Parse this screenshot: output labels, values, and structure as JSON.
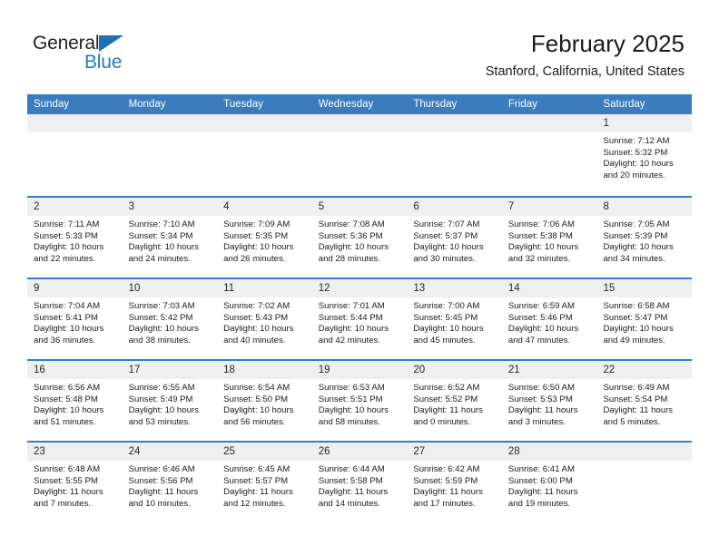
{
  "logo": {
    "word_top": "General",
    "word_bottom": "Blue",
    "triangle_color": "#1f6fb5",
    "blue_color": "#1f7cc4"
  },
  "header": {
    "month_title": "February 2025",
    "location": "Stanford, California, United States"
  },
  "theme": {
    "header_blue": "#3a7cbe",
    "day_strip_gray": "#efefef"
  },
  "labels": {
    "sunrise_prefix": "Sunrise:",
    "sunset_prefix": "Sunset:",
    "daylight_prefix": "Daylight:"
  },
  "weekdays": [
    "Sunday",
    "Monday",
    "Tuesday",
    "Wednesday",
    "Thursday",
    "Friday",
    "Saturday"
  ],
  "weeks": [
    [
      {
        "empty": true
      },
      {
        "empty": true
      },
      {
        "empty": true
      },
      {
        "empty": true
      },
      {
        "empty": true
      },
      {
        "empty": true
      },
      {
        "day": "1",
        "sunrise": "Sunrise: 7:12 AM",
        "sunset": "Sunset: 5:32 PM",
        "daylight_line1": "Daylight: 10 hours",
        "daylight_line2": "and 20 minutes."
      }
    ],
    [
      {
        "day": "2",
        "sunrise": "Sunrise: 7:11 AM",
        "sunset": "Sunset: 5:33 PM",
        "daylight_line1": "Daylight: 10 hours",
        "daylight_line2": "and 22 minutes."
      },
      {
        "day": "3",
        "sunrise": "Sunrise: 7:10 AM",
        "sunset": "Sunset: 5:34 PM",
        "daylight_line1": "Daylight: 10 hours",
        "daylight_line2": "and 24 minutes."
      },
      {
        "day": "4",
        "sunrise": "Sunrise: 7:09 AM",
        "sunset": "Sunset: 5:35 PM",
        "daylight_line1": "Daylight: 10 hours",
        "daylight_line2": "and 26 minutes."
      },
      {
        "day": "5",
        "sunrise": "Sunrise: 7:08 AM",
        "sunset": "Sunset: 5:36 PM",
        "daylight_line1": "Daylight: 10 hours",
        "daylight_line2": "and 28 minutes."
      },
      {
        "day": "6",
        "sunrise": "Sunrise: 7:07 AM",
        "sunset": "Sunset: 5:37 PM",
        "daylight_line1": "Daylight: 10 hours",
        "daylight_line2": "and 30 minutes."
      },
      {
        "day": "7",
        "sunrise": "Sunrise: 7:06 AM",
        "sunset": "Sunset: 5:38 PM",
        "daylight_line1": "Daylight: 10 hours",
        "daylight_line2": "and 32 minutes."
      },
      {
        "day": "8",
        "sunrise": "Sunrise: 7:05 AM",
        "sunset": "Sunset: 5:39 PM",
        "daylight_line1": "Daylight: 10 hours",
        "daylight_line2": "and 34 minutes."
      }
    ],
    [
      {
        "day": "9",
        "sunrise": "Sunrise: 7:04 AM",
        "sunset": "Sunset: 5:41 PM",
        "daylight_line1": "Daylight: 10 hours",
        "daylight_line2": "and 36 minutes."
      },
      {
        "day": "10",
        "sunrise": "Sunrise: 7:03 AM",
        "sunset": "Sunset: 5:42 PM",
        "daylight_line1": "Daylight: 10 hours",
        "daylight_line2": "and 38 minutes."
      },
      {
        "day": "11",
        "sunrise": "Sunrise: 7:02 AM",
        "sunset": "Sunset: 5:43 PM",
        "daylight_line1": "Daylight: 10 hours",
        "daylight_line2": "and 40 minutes."
      },
      {
        "day": "12",
        "sunrise": "Sunrise: 7:01 AM",
        "sunset": "Sunset: 5:44 PM",
        "daylight_line1": "Daylight: 10 hours",
        "daylight_line2": "and 42 minutes."
      },
      {
        "day": "13",
        "sunrise": "Sunrise: 7:00 AM",
        "sunset": "Sunset: 5:45 PM",
        "daylight_line1": "Daylight: 10 hours",
        "daylight_line2": "and 45 minutes."
      },
      {
        "day": "14",
        "sunrise": "Sunrise: 6:59 AM",
        "sunset": "Sunset: 5:46 PM",
        "daylight_line1": "Daylight: 10 hours",
        "daylight_line2": "and 47 minutes."
      },
      {
        "day": "15",
        "sunrise": "Sunrise: 6:58 AM",
        "sunset": "Sunset: 5:47 PM",
        "daylight_line1": "Daylight: 10 hours",
        "daylight_line2": "and 49 minutes."
      }
    ],
    [
      {
        "day": "16",
        "sunrise": "Sunrise: 6:56 AM",
        "sunset": "Sunset: 5:48 PM",
        "daylight_line1": "Daylight: 10 hours",
        "daylight_line2": "and 51 minutes."
      },
      {
        "day": "17",
        "sunrise": "Sunrise: 6:55 AM",
        "sunset": "Sunset: 5:49 PM",
        "daylight_line1": "Daylight: 10 hours",
        "daylight_line2": "and 53 minutes."
      },
      {
        "day": "18",
        "sunrise": "Sunrise: 6:54 AM",
        "sunset": "Sunset: 5:50 PM",
        "daylight_line1": "Daylight: 10 hours",
        "daylight_line2": "and 56 minutes."
      },
      {
        "day": "19",
        "sunrise": "Sunrise: 6:53 AM",
        "sunset": "Sunset: 5:51 PM",
        "daylight_line1": "Daylight: 10 hours",
        "daylight_line2": "and 58 minutes."
      },
      {
        "day": "20",
        "sunrise": "Sunrise: 6:52 AM",
        "sunset": "Sunset: 5:52 PM",
        "daylight_line1": "Daylight: 11 hours",
        "daylight_line2": "and 0 minutes."
      },
      {
        "day": "21",
        "sunrise": "Sunrise: 6:50 AM",
        "sunset": "Sunset: 5:53 PM",
        "daylight_line1": "Daylight: 11 hours",
        "daylight_line2": "and 3 minutes."
      },
      {
        "day": "22",
        "sunrise": "Sunrise: 6:49 AM",
        "sunset": "Sunset: 5:54 PM",
        "daylight_line1": "Daylight: 11 hours",
        "daylight_line2": "and 5 minutes."
      }
    ],
    [
      {
        "day": "23",
        "sunrise": "Sunrise: 6:48 AM",
        "sunset": "Sunset: 5:55 PM",
        "daylight_line1": "Daylight: 11 hours",
        "daylight_line2": "and 7 minutes."
      },
      {
        "day": "24",
        "sunrise": "Sunrise: 6:46 AM",
        "sunset": "Sunset: 5:56 PM",
        "daylight_line1": "Daylight: 11 hours",
        "daylight_line2": "and 10 minutes."
      },
      {
        "day": "25",
        "sunrise": "Sunrise: 6:45 AM",
        "sunset": "Sunset: 5:57 PM",
        "daylight_line1": "Daylight: 11 hours",
        "daylight_line2": "and 12 minutes."
      },
      {
        "day": "26",
        "sunrise": "Sunrise: 6:44 AM",
        "sunset": "Sunset: 5:58 PM",
        "daylight_line1": "Daylight: 11 hours",
        "daylight_line2": "and 14 minutes."
      },
      {
        "day": "27",
        "sunrise": "Sunrise: 6:42 AM",
        "sunset": "Sunset: 5:59 PM",
        "daylight_line1": "Daylight: 11 hours",
        "daylight_line2": "and 17 minutes."
      },
      {
        "day": "28",
        "sunrise": "Sunrise: 6:41 AM",
        "sunset": "Sunset: 6:00 PM",
        "daylight_line1": "Daylight: 11 hours",
        "daylight_line2": "and 19 minutes."
      },
      {
        "empty": true
      }
    ]
  ]
}
